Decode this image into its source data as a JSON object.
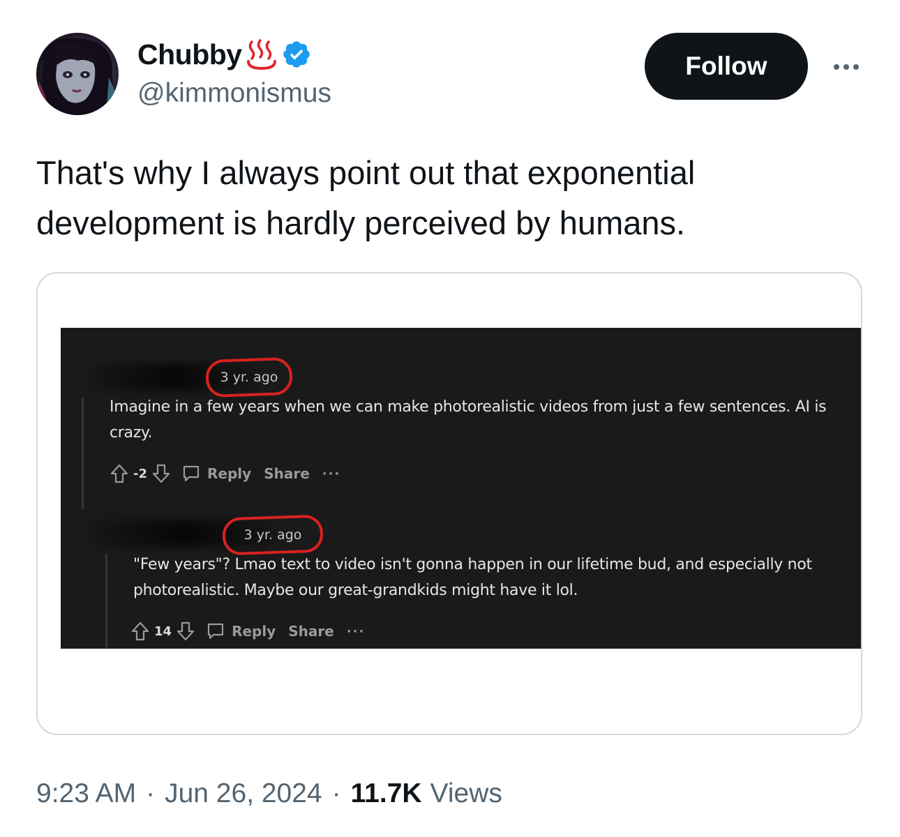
{
  "author": {
    "display_name": "Chubby",
    "emoji": "♨️",
    "verified": true,
    "handle": "@kimmonismus",
    "avatar_icon": "anime-girl-avatar"
  },
  "actions": {
    "follow_label": "Follow"
  },
  "tweet": {
    "line1": "That's why I always point out that exponential",
    "line2": "development is hardly perceived by humans."
  },
  "embedded_image": {
    "comment1": {
      "timestamp": "3 yr. ago",
      "line1": "Imagine in a few years when we can make photorealistic videos from just a few sentences. AI is",
      "line2": "crazy.",
      "score": "-2",
      "reply": "Reply",
      "share": "Share",
      "more": "···"
    },
    "comment2": {
      "timestamp": "3 yr. ago",
      "line1": "\"Few years\"? Lmao text to video isn't gonna happen in our lifetime bud, and especially not",
      "line2": "photorealistic. Maybe our great-grandkids might have it lol.",
      "score": "14",
      "reply": "Reply",
      "share": "Share",
      "more": "···"
    }
  },
  "meta": {
    "time": "9:23 AM",
    "date": "Jun 26, 2024",
    "dot": "·",
    "views_count": "11.7K",
    "views_label": "Views"
  },
  "colors": {
    "text": "#0f1419",
    "secondary": "#536471",
    "verified": "#1d9bf0",
    "highlight_circle": "#d8221f",
    "reddit_bg": "#1a1a1b"
  }
}
